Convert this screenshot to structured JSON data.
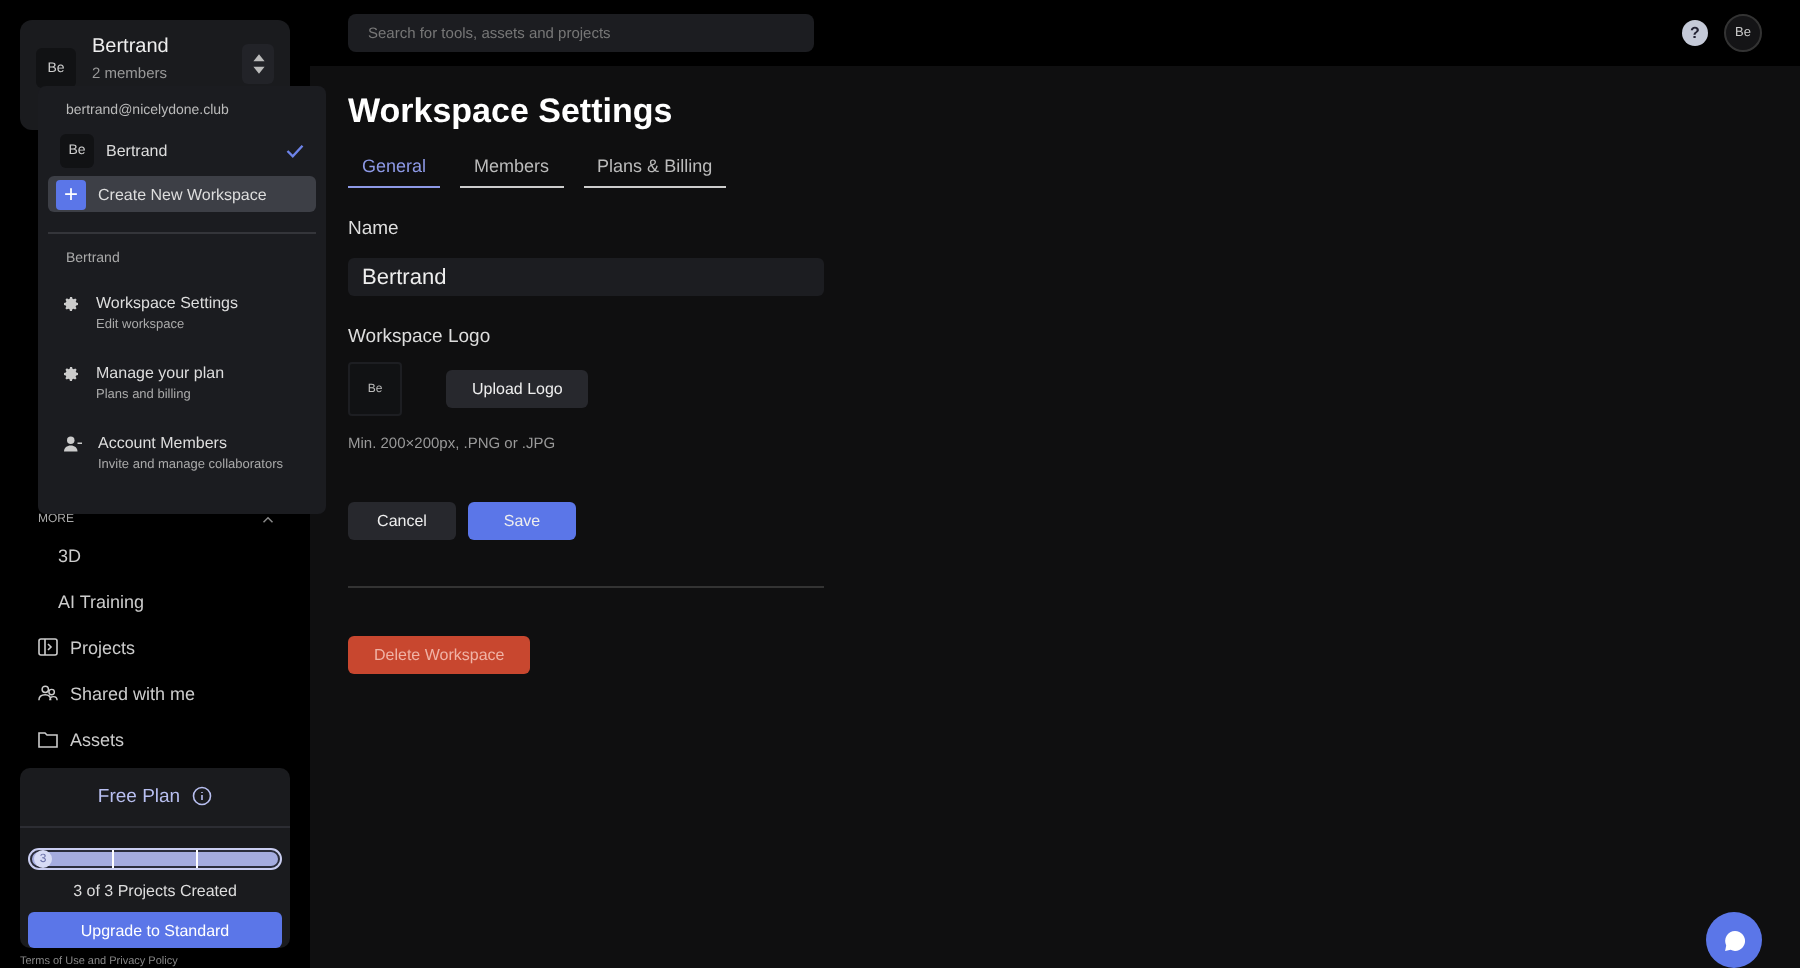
{
  "workspace_switcher": {
    "avatar": "Be",
    "name": "Bertrand",
    "members": "2 members"
  },
  "dropdown": {
    "email": "bertrand@nicelydone.club",
    "workspaces": [
      {
        "avatar": "Be",
        "name": "Bertrand",
        "selected": true
      }
    ],
    "create": {
      "icon": "+",
      "label": "Create New Workspace"
    },
    "section": "Bertrand",
    "items": [
      {
        "kind": "gear",
        "title": "Workspace Settings",
        "subtitle": "Edit workspace"
      },
      {
        "kind": "gear",
        "title": "Manage your plan",
        "subtitle": "Plans and billing"
      },
      {
        "kind": "person",
        "title": "Account Members",
        "subtitle": "Invite and manage collaborators"
      }
    ]
  },
  "sidebar": {
    "group": {
      "label": "MORE",
      "expanded": true,
      "items": [
        "3D",
        "AI Training"
      ]
    },
    "items": [
      {
        "kind": "projects",
        "label": "Projects"
      },
      {
        "kind": "shared",
        "label": "Shared with me"
      },
      {
        "kind": "folder",
        "label": "Assets"
      }
    ],
    "plan": {
      "title": "Free Plan",
      "count": "3",
      "level": 1,
      "caption": "3 of 3 Projects Created",
      "button": "Upgrade to Standard"
    },
    "footer": "Terms of Use and Privacy Policy"
  },
  "search": {
    "placeholder": "Search for tools, assets and projects"
  },
  "help": "?",
  "user_avatar": "Be",
  "page": {
    "title": "Workspace Settings",
    "tabs": [
      {
        "label": "General",
        "selected": true
      },
      {
        "label": "Members",
        "selected": false
      },
      {
        "label": "Plans & Billing",
        "selected": false
      }
    ],
    "name_label": "Name",
    "name_value": "Bertrand",
    "logo_label": "Workspace Logo",
    "logo": "Be",
    "upload": "Upload Logo",
    "hint": "Min. 200×200px, .PNG or .JPG",
    "cancel": "Cancel",
    "save": "Save",
    "delete": "Delete Workspace"
  }
}
